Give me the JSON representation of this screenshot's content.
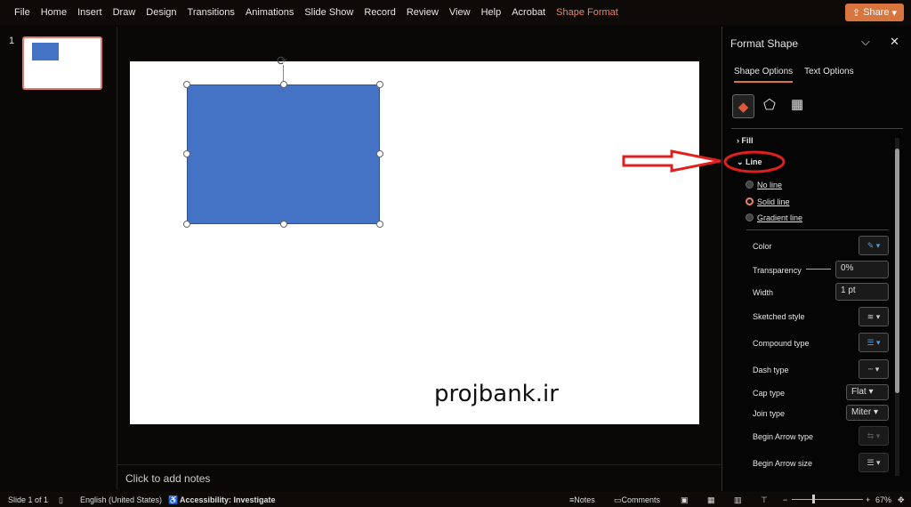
{
  "menubar": {
    "items": [
      "File",
      "Home",
      "Insert",
      "Draw",
      "Design",
      "Transitions",
      "Animations",
      "Slide Show",
      "Record",
      "Review",
      "View",
      "Help",
      "Acrobat",
      "Shape Format"
    ],
    "active": "Shape Format",
    "share": "Share"
  },
  "thumbnails": {
    "number": "1"
  },
  "slide": {
    "watermark": "projbank.ir",
    "shape_color": "#4472c4"
  },
  "notes": {
    "placeholder": "Click to add notes"
  },
  "panel": {
    "title": "Format Shape",
    "tabs": [
      "Shape Options",
      "Text Options"
    ],
    "sections": {
      "fill": "Fill",
      "line": "Line"
    },
    "radios": [
      "No line",
      "Solid line",
      "Gradient line"
    ],
    "selected_radio": "Solid line",
    "rows": {
      "color": "Color",
      "transparency": "Transparency",
      "transparency_value": "0%",
      "width": "Width",
      "width_value": "1 pt",
      "sketched": "Sketched style",
      "compound": "Compound type",
      "dash": "Dash type",
      "cap": "Cap type",
      "cap_value": "Flat",
      "join": "Join type",
      "join_value": "Miter",
      "begin_type": "Begin Arrow type",
      "begin_size": "Begin Arrow size"
    }
  },
  "status": {
    "slide": "Slide 1 of 1",
    "language": "English (United States)",
    "accessibility": "Accessibility: Investigate",
    "notes": "Notes",
    "comments": "Comments",
    "zoom": "67%"
  },
  "annotation_color": "#e0201c"
}
